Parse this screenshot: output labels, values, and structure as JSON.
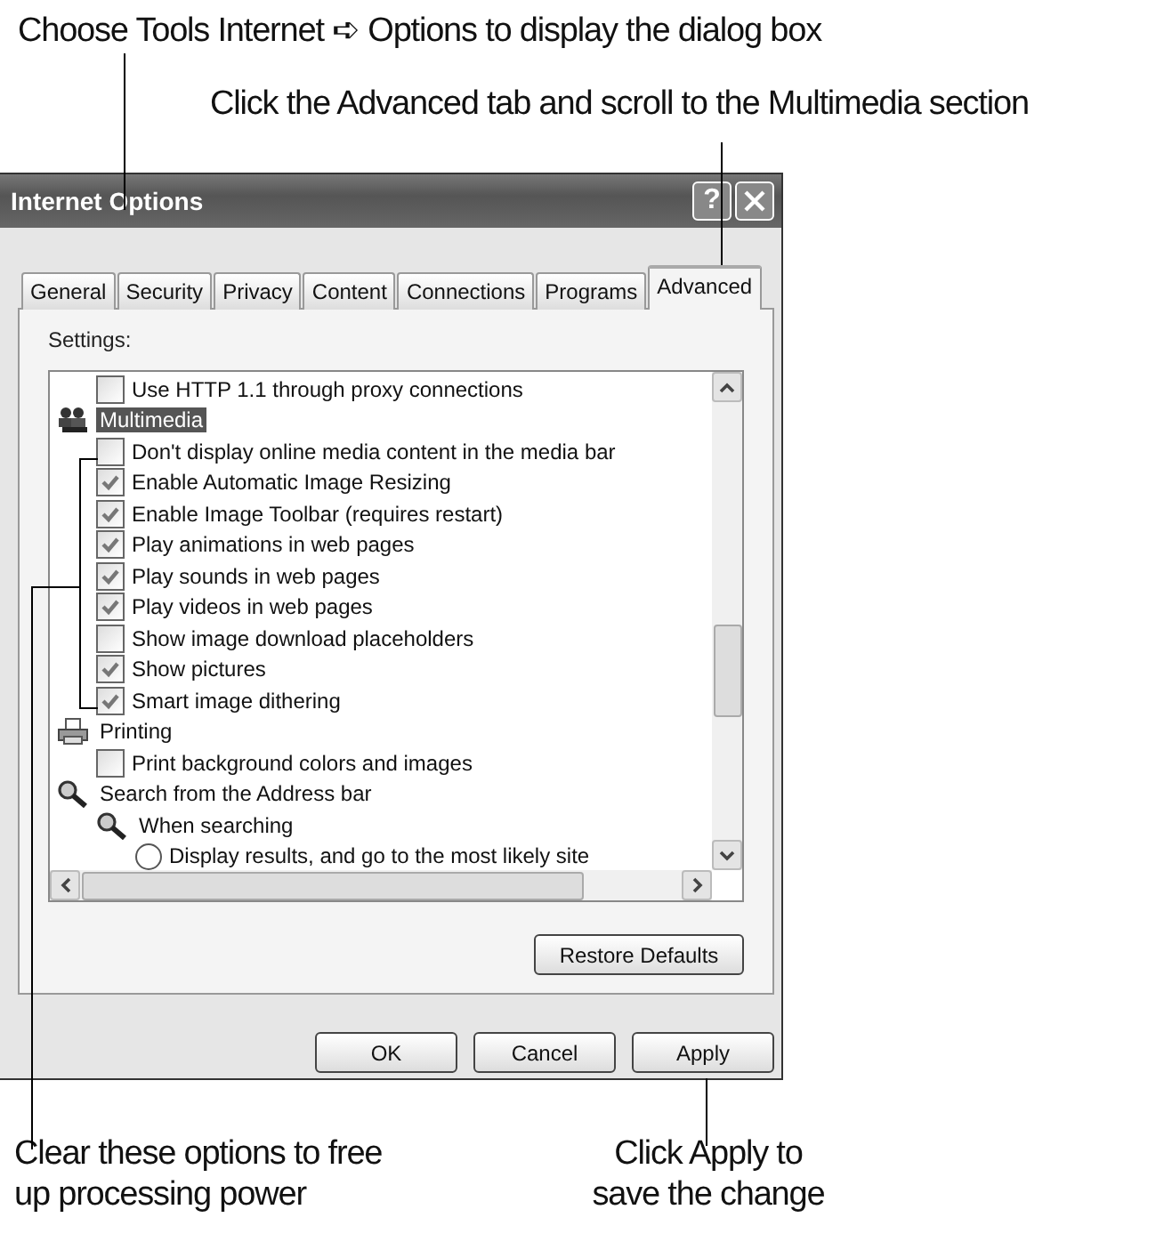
{
  "callouts_top": [
    "Choose Tools Internet ➪ Options to display the dialog box",
    "Click the Advanced tab and scroll to the Multimedia section"
  ],
  "window": {
    "title": "Internet Options",
    "help_button": "?"
  },
  "tabs": [
    {
      "label": "General",
      "selected": false
    },
    {
      "label": "Security",
      "selected": false
    },
    {
      "label": "Privacy",
      "selected": false
    },
    {
      "label": "Content",
      "selected": false
    },
    {
      "label": "Connections",
      "selected": false
    },
    {
      "label": "Programs",
      "selected": false
    },
    {
      "label": "Advanced",
      "selected": true
    }
  ],
  "settings_label": "Settings:",
  "settings": [
    {
      "kind": "checkbox",
      "label": "Use HTTP 1.1 through proxy connections",
      "checked": false
    },
    {
      "kind": "media",
      "label": "Multimedia",
      "selected": true,
      "children": [
        {
          "kind": "checkbox",
          "label": "Don't display online media content in the media bar",
          "checked": false
        },
        {
          "kind": "checkbox",
          "label": "Enable Automatic Image Resizing",
          "checked": true
        },
        {
          "kind": "checkbox",
          "label": "Enable Image Toolbar (requires restart)",
          "checked": true
        },
        {
          "kind": "checkbox",
          "label": "Play animations in web pages",
          "checked": true
        },
        {
          "kind": "checkbox",
          "label": "Play sounds in web pages",
          "checked": true
        },
        {
          "kind": "checkbox",
          "label": "Play videos in web pages",
          "checked": true
        },
        {
          "kind": "checkbox",
          "label": "Show image download placeholders",
          "checked": false
        },
        {
          "kind": "checkbox",
          "label": "Show pictures",
          "checked": true
        },
        {
          "kind": "checkbox",
          "label": "Smart image dithering",
          "checked": true
        }
      ]
    },
    {
      "kind": "printer",
      "label": "Printing",
      "selected": false,
      "children": [
        {
          "kind": "checkbox",
          "label": "Print background colors and images",
          "checked": false
        }
      ]
    },
    {
      "kind": "search",
      "label": "Search from the Address bar",
      "selected": false,
      "children": [
        {
          "kind": "search",
          "label": "When searching",
          "selected": false,
          "children": [
            {
              "kind": "radio",
              "label": "Display results, and go to the most likely site",
              "selected": false
            }
          ]
        }
      ]
    }
  ],
  "restore_button": "Restore Defaults",
  "buttons": [
    "OK",
    "Cancel",
    "Apply"
  ],
  "callouts_bottom": [
    "Clear these options to free up processing power",
    "Click Apply to save the change"
  ]
}
